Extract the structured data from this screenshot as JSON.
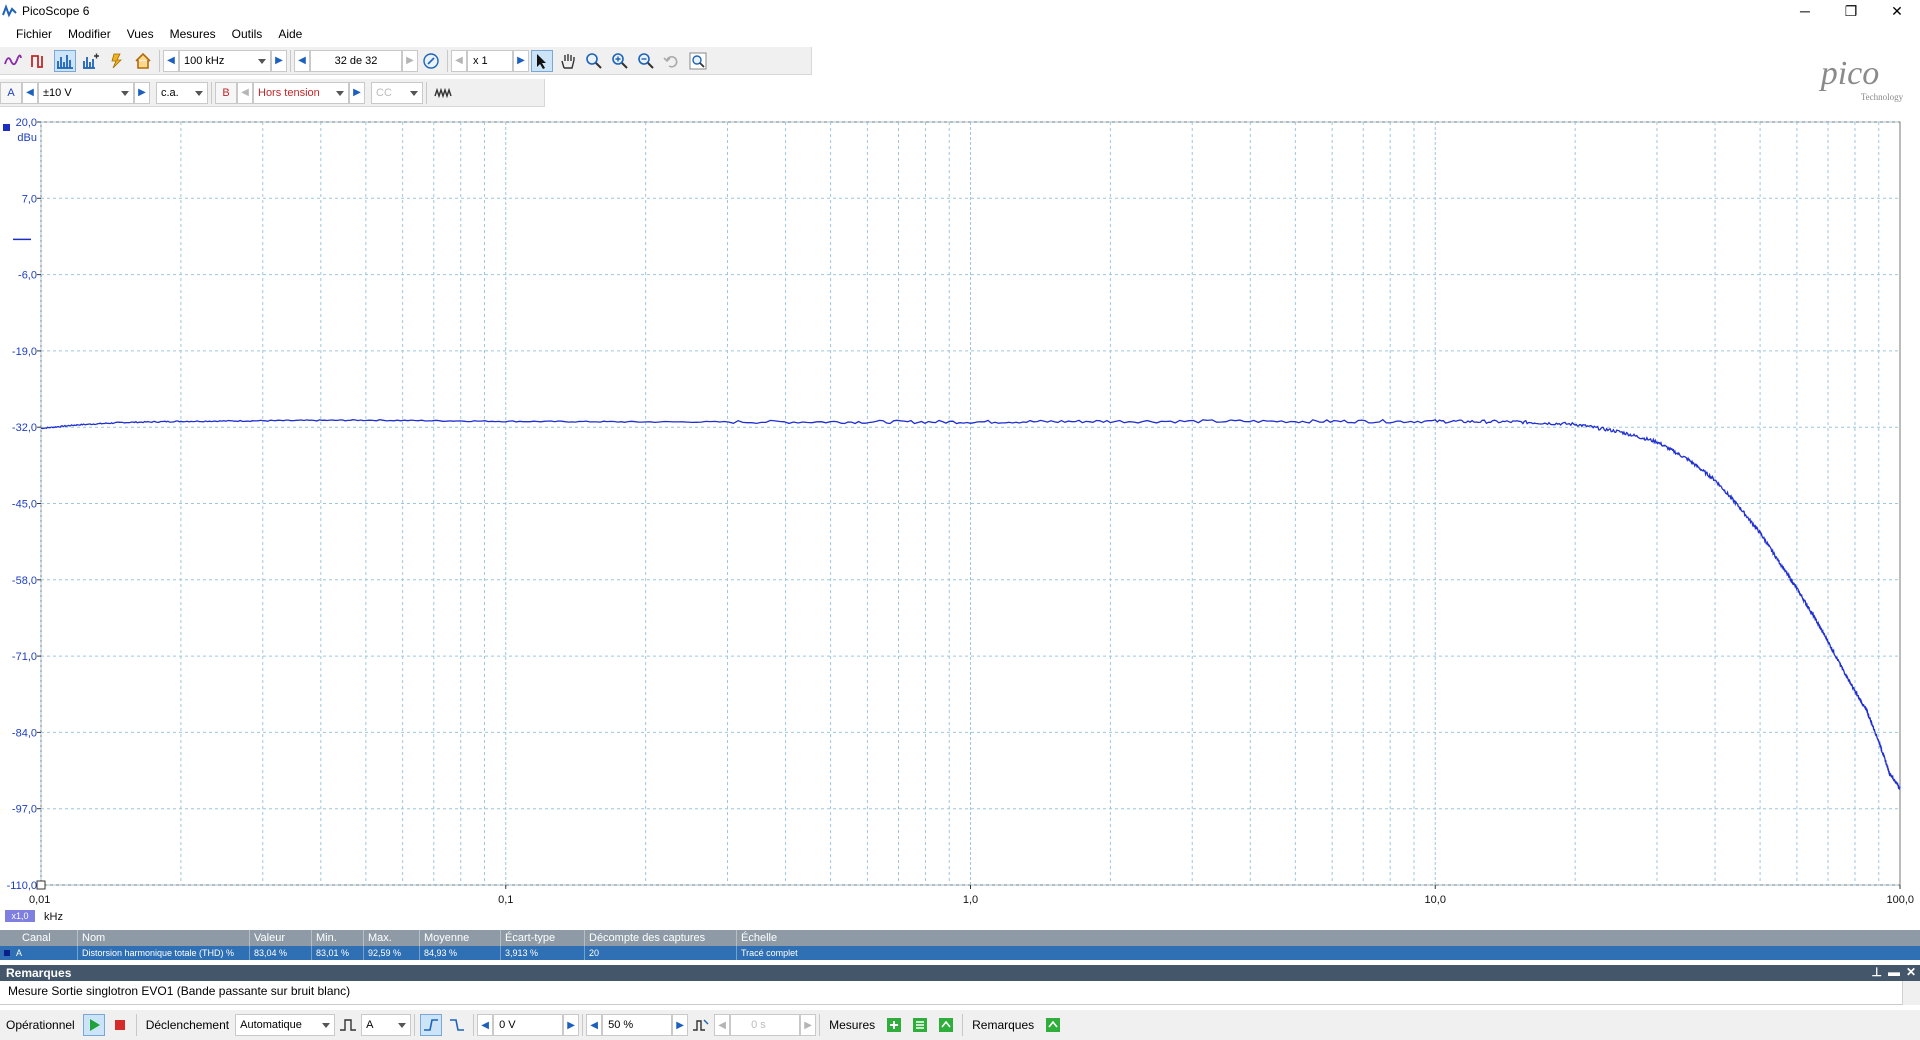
{
  "window": {
    "title": "PicoScope 6",
    "minimize": "─",
    "restore": "❐",
    "close": "✕"
  },
  "menu": [
    "Fichier",
    "Modifier",
    "Vues",
    "Mesures",
    "Outils",
    "Aide"
  ],
  "toolbar1": {
    "bandwidth_value": "100 kHz",
    "capture_counter": "32 de 32",
    "zoom_factor": "x 1"
  },
  "toolbar2": {
    "channel_a_label": "A",
    "channel_a_range": "±10 V",
    "channel_a_coupling": "c.a.",
    "channel_b_label": "B",
    "channel_b_range": "Hors tension",
    "channel_b_coupling": "CC"
  },
  "logo": {
    "text": "pico",
    "subtext": "Technology"
  },
  "plot": {
    "zoom_badge": "x1,0",
    "x_unit": "kHz",
    "y_unit": "dBu",
    "trace_color": "#1f2fd0",
    "grid_color": "#9ec7dc"
  },
  "chart_data": {
    "type": "line",
    "xscale": "log",
    "xlim": [
      0.01,
      100.0
    ],
    "ylim": [
      -110.0,
      20.0
    ],
    "x_ticks": [
      "0,01",
      "0,1",
      "1,0",
      "10,0",
      "100,0"
    ],
    "x_tick_values": [
      0.01,
      0.1,
      1.0,
      10.0,
      100.0
    ],
    "y_ticks": [
      "20,0",
      "7,0",
      "-6,0",
      "-19,0",
      "-32,0",
      "-45,0",
      "-58,0",
      "-71,0",
      "-84,0",
      "-97,0",
      "-110,0"
    ],
    "y_tick_values": [
      20,
      7,
      -6,
      -19,
      -32,
      -45,
      -58,
      -71,
      -84,
      -97,
      -110
    ],
    "xlabel": "kHz",
    "ylabel": "dBu",
    "grid": true,
    "series": [
      {
        "name": "A",
        "x": [
          0.01,
          0.012,
          0.015,
          0.02,
          0.03,
          0.05,
          0.1,
          0.2,
          0.5,
          1.0,
          2.0,
          5.0,
          10.0,
          15.0,
          20.0,
          25.0,
          30.0,
          35.0,
          40.0,
          45.0,
          50.0,
          55.0,
          60.0,
          65.0,
          70.0,
          75.0,
          80.0,
          85.0,
          90.0,
          95.0,
          100.0
        ],
        "y": [
          -32.2,
          -31.6,
          -31.2,
          -31.0,
          -30.9,
          -30.8,
          -31.0,
          -31.1,
          -31.1,
          -31.1,
          -31.0,
          -31.0,
          -31.0,
          -31.1,
          -31.5,
          -32.8,
          -34.5,
          -37.5,
          -41.0,
          -45.5,
          -50.0,
          -55.0,
          -59.5,
          -64.0,
          -68.5,
          -73.0,
          -77.0,
          -80.5,
          -85.5,
          -91.0,
          -93.5
        ]
      }
    ]
  },
  "measurements": {
    "headers": [
      "Canal",
      "Nom",
      "Valeur",
      "Min.",
      "Max.",
      "Moyenne",
      "Écart-type",
      "Décompte des captures",
      "Échelle"
    ],
    "row": [
      "A",
      "Distorsion harmonique totale (THD) %",
      "83,04 %",
      "83,01 %",
      "92,59 %",
      "84,93 %",
      "3,913 %",
      "20",
      "Tracé complet"
    ]
  },
  "remarks": {
    "title": "Remarques",
    "text": "Mesure Sortie singlotron EVO1 (Bande passante sur bruit blanc)"
  },
  "status": {
    "state": "Opérationnel",
    "trigger_label": "Déclenchement",
    "trigger_mode": "Automatique",
    "trigger_source": "A",
    "trigger_level": "0 V",
    "pretrigger": "50 %",
    "delay": "0 s",
    "measures_label": "Mesures",
    "notes_label": "Remarques"
  }
}
